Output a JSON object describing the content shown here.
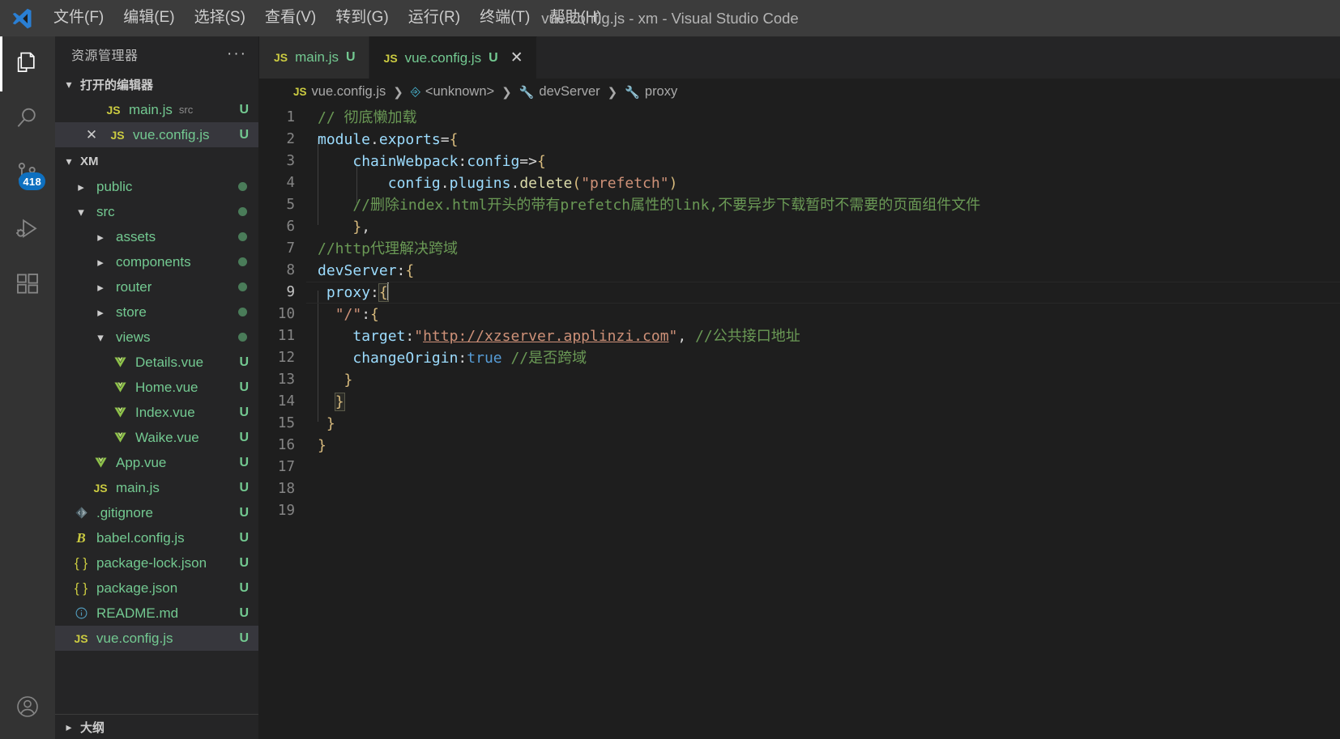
{
  "titlebar": {
    "logo_icon": "vscode-logo-icon",
    "title": "vue.config.js - xm - Visual Studio Code",
    "menus": [
      {
        "label": "文件(F)",
        "name": "menu-file"
      },
      {
        "label": "编辑(E)",
        "name": "menu-edit"
      },
      {
        "label": "选择(S)",
        "name": "menu-selection"
      },
      {
        "label": "查看(V)",
        "name": "menu-view"
      },
      {
        "label": "转到(G)",
        "name": "menu-go"
      },
      {
        "label": "运行(R)",
        "name": "menu-run"
      },
      {
        "label": "终端(T)",
        "name": "menu-terminal"
      },
      {
        "label": "帮助(H)",
        "name": "menu-help"
      }
    ]
  },
  "activitybar": {
    "items": [
      {
        "icon": "files-explorer-icon",
        "active": true,
        "badge": ""
      },
      {
        "icon": "search-icon",
        "active": false,
        "badge": ""
      },
      {
        "icon": "source-control-icon",
        "active": false,
        "badge": "418"
      },
      {
        "icon": "run-and-debug-icon",
        "active": false,
        "badge": ""
      },
      {
        "icon": "extensions-icon",
        "active": false,
        "badge": ""
      }
    ],
    "account_icon": "account-icon",
    "badge_color": "#0e70c0"
  },
  "sidebar": {
    "title": "资源管理器",
    "more_actions": "···",
    "open_editors": {
      "label": "打开的编辑器",
      "expanded": true,
      "items": [
        {
          "name": "main.js",
          "sub": "src",
          "status": "U",
          "icon": "js-file-icon",
          "selected": false,
          "closable": false
        },
        {
          "name": "vue.config.js",
          "sub": "",
          "status": "U",
          "icon": "js-file-icon",
          "selected": true,
          "closable": true
        }
      ]
    },
    "project": {
      "label": "XM",
      "expanded": true,
      "tree": [
        {
          "label": "public",
          "type": "folder",
          "depth": 1,
          "expanded": false,
          "status": "dot",
          "icon": "chevron-right-icon"
        },
        {
          "label": "src",
          "type": "folder",
          "depth": 1,
          "expanded": true,
          "status": "dot",
          "icon": "chevron-down-icon"
        },
        {
          "label": "assets",
          "type": "folder",
          "depth": 2,
          "expanded": false,
          "status": "dot",
          "icon": "chevron-right-icon"
        },
        {
          "label": "components",
          "type": "folder",
          "depth": 2,
          "expanded": false,
          "status": "dot",
          "icon": "chevron-right-icon"
        },
        {
          "label": "router",
          "type": "folder",
          "depth": 2,
          "expanded": false,
          "status": "dot",
          "icon": "chevron-right-icon"
        },
        {
          "label": "store",
          "type": "folder",
          "depth": 2,
          "expanded": false,
          "status": "dot",
          "icon": "chevron-right-icon"
        },
        {
          "label": "views",
          "type": "folder",
          "depth": 2,
          "expanded": true,
          "status": "dot",
          "icon": "chevron-down-icon"
        },
        {
          "label": "Details.vue",
          "type": "vue",
          "depth": 3,
          "status": "U",
          "icon": "vue-file-icon"
        },
        {
          "label": "Home.vue",
          "type": "vue",
          "depth": 3,
          "status": "U",
          "icon": "vue-file-icon"
        },
        {
          "label": "Index.vue",
          "type": "vue",
          "depth": 3,
          "status": "U",
          "icon": "vue-file-icon"
        },
        {
          "label": "Waike.vue",
          "type": "vue",
          "depth": 3,
          "status": "U",
          "icon": "vue-file-icon"
        },
        {
          "label": "App.vue",
          "type": "vue",
          "depth": 2,
          "status": "U",
          "icon": "vue-file-icon"
        },
        {
          "label": "main.js",
          "type": "js",
          "depth": 2,
          "status": "U",
          "icon": "js-file-icon"
        },
        {
          "label": ".gitignore",
          "type": "git",
          "depth": 1,
          "status": "U",
          "icon": "git-file-icon"
        },
        {
          "label": "babel.config.js",
          "type": "babel",
          "depth": 1,
          "status": "U",
          "icon": "babel-file-icon"
        },
        {
          "label": "package-lock.json",
          "type": "json",
          "depth": 1,
          "status": "U",
          "icon": "json-file-icon"
        },
        {
          "label": "package.json",
          "type": "json",
          "depth": 1,
          "status": "U",
          "icon": "json-file-icon"
        },
        {
          "label": "README.md",
          "type": "md",
          "depth": 1,
          "status": "U",
          "icon": "markdown-file-icon"
        },
        {
          "label": "vue.config.js",
          "type": "js",
          "depth": 1,
          "status": "U",
          "icon": "js-file-icon",
          "selected": true
        }
      ]
    },
    "outline": {
      "label": "大纲",
      "expanded": false
    }
  },
  "editor": {
    "tabs": [
      {
        "label": "main.js",
        "status": "U",
        "active": false,
        "icon": "js-file-icon",
        "close": ""
      },
      {
        "label": "vue.config.js",
        "status": "U",
        "active": true,
        "icon": "js-file-icon",
        "close": "✕"
      }
    ],
    "breadcrumbs": [
      {
        "label": "vue.config.js",
        "icon": "js-file-icon"
      },
      {
        "label": "<unknown>",
        "icon": "symbol-module-icon"
      },
      {
        "label": "devServer",
        "icon": "symbol-property-icon"
      },
      {
        "label": "proxy",
        "icon": "symbol-property-icon"
      }
    ],
    "separator": "❯",
    "cursor_line": 9,
    "line_numbers": [
      1,
      2,
      3,
      4,
      5,
      6,
      7,
      8,
      9,
      10,
      11,
      12,
      13,
      14,
      15,
      16,
      17,
      18,
      19
    ],
    "lines": [
      "// 彻底懒加载",
      "module.exports={",
      "    chainWebpack:config=>{",
      "        config.plugins.delete(\"prefetch\")",
      "    //删除index.html开头的带有prefetch属性的link,不要异步下载暂时不需要的页面组件文件",
      "    },",
      "//http代理解决跨域",
      "devServer:{",
      " proxy:{",
      "  \"/\":{",
      "    target:\"http://xzserver.applinzi.com\", //公共接口地址",
      "    changeOrigin:true //是否跨域",
      "   }",
      "  }",
      " }",
      "}",
      "",
      "",
      ""
    ],
    "colors": {
      "background": "#1e1e1e",
      "comment": "#6a9955",
      "string": "#ce9178",
      "keyword": "#569cd6",
      "property": "#9cdcfe",
      "function": "#dcdcaa",
      "bracket_yellow": "#d7ba7d",
      "bracket_purple": "#da70d6",
      "foreground": "#d4d4d4"
    }
  }
}
